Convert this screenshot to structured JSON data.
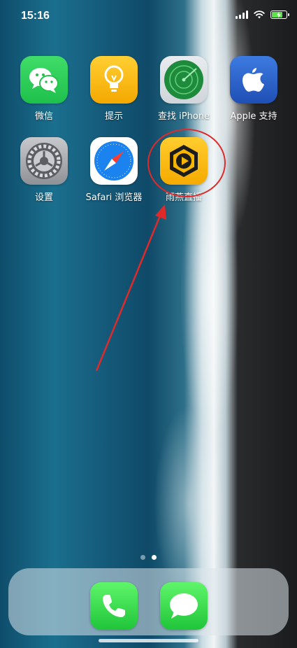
{
  "status_bar": {
    "time": "15:16",
    "battery_level": 0.8,
    "battery_charging": true
  },
  "apps": [
    {
      "label": "微信",
      "icon": "wechat-icon",
      "color": "#29c957"
    },
    {
      "label": "提示",
      "icon": "lightbulb-icon",
      "color": "#fbbd17"
    },
    {
      "label": "查找 iPhone",
      "icon": "radar-icon",
      "color": "#2fa34a"
    },
    {
      "label": "Apple 支持",
      "icon": "apple-icon",
      "color": "#2b63c9"
    },
    {
      "label": "设置",
      "icon": "gear-icon",
      "color": "#9a9da2"
    },
    {
      "label": "Safari 浏览器",
      "icon": "compass-icon",
      "color": "#1a83f0"
    },
    {
      "label": "雨燕直播",
      "icon": "hexagon-play-icon",
      "color": "#f7b500"
    }
  ],
  "annotation": {
    "color": "#e02a2a",
    "target": "雨燕直播"
  },
  "page_indicator": {
    "pages": 2,
    "current": 2
  },
  "dock": [
    {
      "icon": "phone-icon",
      "color": "#34d04a"
    },
    {
      "icon": "messages-icon",
      "color": "#34d04a"
    }
  ]
}
